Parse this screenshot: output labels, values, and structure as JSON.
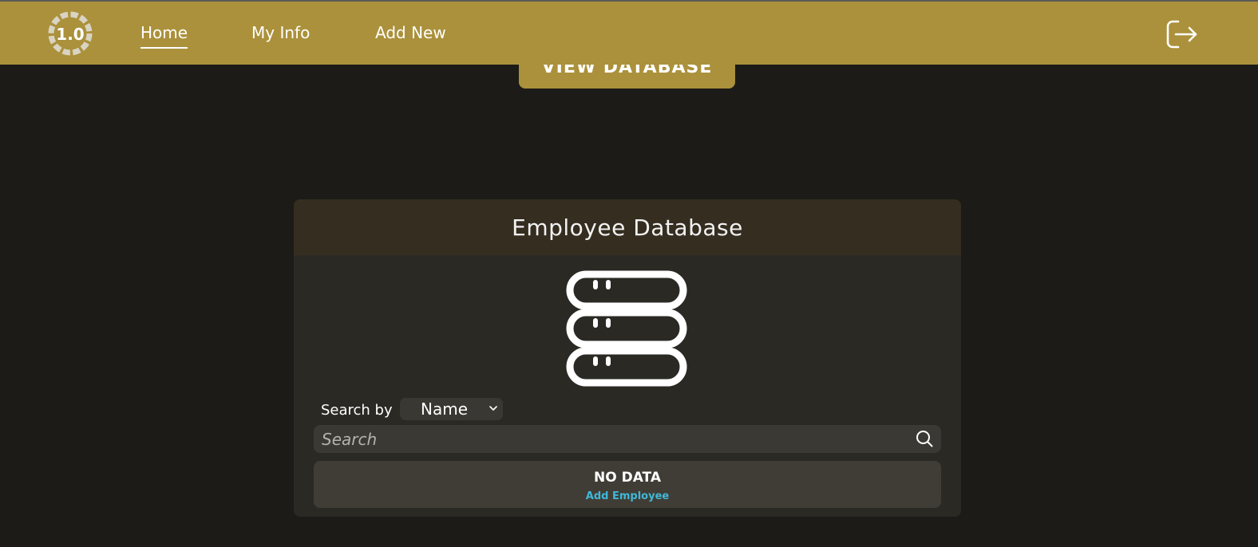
{
  "navbar": {
    "logo_text": "1.0",
    "links": [
      {
        "label": "Home",
        "active": true
      },
      {
        "label": "My Info",
        "active": false
      },
      {
        "label": "Add New",
        "active": false
      }
    ]
  },
  "hero": {
    "button_label": "VIEW DATABASE"
  },
  "card": {
    "title": "Employee Database",
    "search_by_label": "Search by",
    "search_by_value": "Name",
    "search_placeholder": "Search",
    "empty_title": "NO DATA",
    "empty_action": "Add Employee"
  },
  "colors": {
    "accent": "#ab913b",
    "background": "#1c1b17",
    "link": "#3fb8d8"
  },
  "icons": [
    "logo-icon",
    "logout-icon",
    "database-icon",
    "chevron-down-icon",
    "search-icon"
  ]
}
